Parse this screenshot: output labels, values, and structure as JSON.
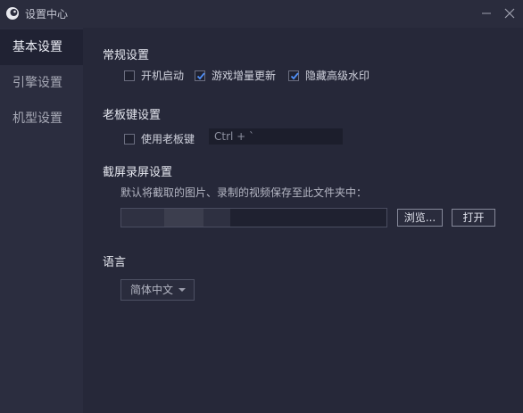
{
  "window": {
    "title": "设置中心"
  },
  "colors": {
    "accent_check": "#4f8ef7",
    "background": "#262839",
    "sidebar": "#2b2d3f"
  },
  "sidebar": {
    "items": [
      {
        "label": "基本设置",
        "active": true
      },
      {
        "label": "引擎设置",
        "active": false
      },
      {
        "label": "机型设置",
        "active": false
      }
    ]
  },
  "general": {
    "title": "常规设置",
    "options": [
      {
        "label": "开机启动",
        "checked": false
      },
      {
        "label": "游戏增量更新",
        "checked": true
      },
      {
        "label": "隐藏高级水印",
        "checked": true
      }
    ]
  },
  "boss_key": {
    "title": "老板键设置",
    "enable_label": "使用老板键",
    "enabled": false,
    "hotkey_value": "Ctrl + `"
  },
  "screenshot": {
    "title": "截屏录屏设置",
    "description": "默认将截取的图片、录制的视频保存至此文件夹中：",
    "browse_label": "浏览...",
    "open_label": "打开"
  },
  "language": {
    "title": "语言",
    "selected": "简体中文"
  },
  "icons": {
    "app": "app-logo-icon",
    "minimize": "minimize-icon",
    "close": "close-icon",
    "check": "check-icon",
    "dropdown": "chevron-down-icon"
  }
}
